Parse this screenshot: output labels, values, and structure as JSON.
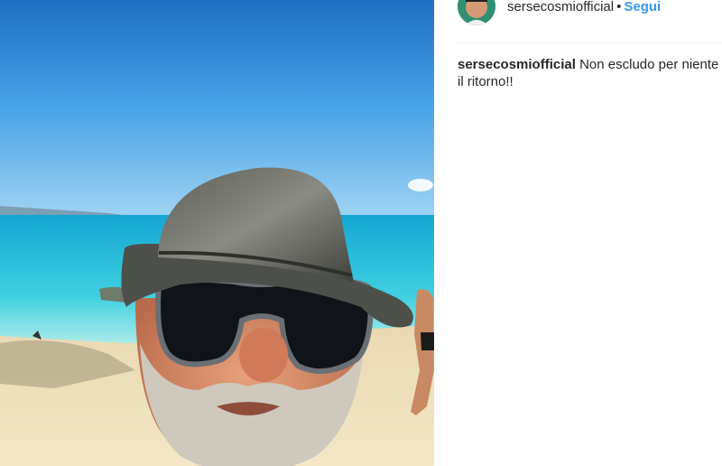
{
  "post": {
    "username": "sersecosmiofficial",
    "separator": "•",
    "follow_label": "Segui",
    "caption_user": "sersecosmiofficial",
    "caption_text": "Non escludo per niente il ritorno!!"
  },
  "colors": {
    "link": "#3897f0",
    "text": "#262626",
    "divider": "#efefef"
  }
}
